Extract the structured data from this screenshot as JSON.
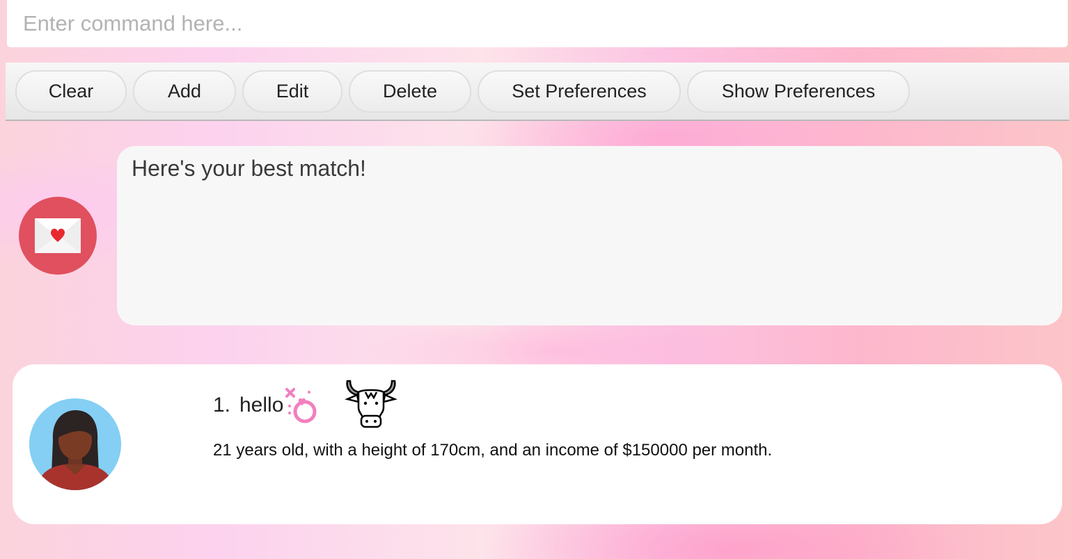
{
  "command_box": {
    "placeholder": "Enter command here...",
    "value": ""
  },
  "toolbar": {
    "buttons": [
      {
        "label": "Clear"
      },
      {
        "label": "Add"
      },
      {
        "label": "Edit"
      },
      {
        "label": "Delete"
      },
      {
        "label": "Set Preferences"
      },
      {
        "label": "Show Preferences"
      }
    ]
  },
  "response": {
    "avatar_icon": "envelope-heart-icon",
    "message": "Here's your best match!"
  },
  "match": {
    "index": "1.",
    "name": "hello",
    "gender_icon": "female-gender-icon",
    "zodiac_icon": "ox-icon",
    "avatar_icon": "female-person-avatar",
    "details": "21 years old, with a height of 170cm, and an income of $150000 per month."
  },
  "colors": {
    "bot_avatar": "#e0505f",
    "person_avatar_bg": "#84cff3",
    "gender_icon": "#f27fbf"
  }
}
